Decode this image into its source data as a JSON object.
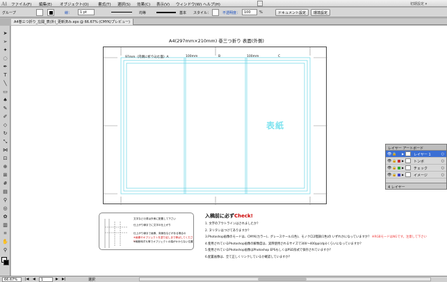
{
  "app": {
    "logo": "Ai",
    "workspace": "初期設定 ▾"
  },
  "menu": [
    "ファイル(F)",
    "編集(E)",
    "オブジェクト(O)",
    "書式(T)",
    "選択(S)",
    "効果(C)",
    "表示(V)",
    "ウィンドウ(W)",
    "ヘルプ(H)"
  ],
  "control": {
    "selection": "グループ",
    "stroke_label": "線：",
    "stroke_weight": "1 pt",
    "profile": "均等",
    "brush": "基本",
    "style_label": "スタイル：",
    "opacity_label": "不透明度：",
    "opacity": "100",
    "opacity_unit": "%",
    "doc_setup": "ドキュメント設定",
    "prefs": "環境設定"
  },
  "tab": {
    "title": "A4巻三つ折り_左開_表(外)_更新済み.eps @ 66.67% (CMYK/プレビュー)"
  },
  "document": {
    "title": "A4(297mm×210mm) 巻三つ折り 表面(外側)",
    "col_labels": [
      "97mm（内側に折り込む面）A",
      "100mm",
      "B",
      "100mm",
      "C"
    ],
    "panel_text": "表紙"
  },
  "guide": {
    "lines": [
      "文字などの書は外側に配置して下さい",
      "仕上がり線までに文字の仕上がり",
      "仕上がり線まで画像、背景色などがある場合の",
      "※画像やオブジェクトを塗り足しまで伸ばしてください",
      "※裁断時ずれ等でオブジェクトの端がかからない位置"
    ]
  },
  "checklist": {
    "title_prefix": "入稿前に必ず",
    "title_suffix": "Check!",
    "items": [
      "1. 文字のアウトラインはされましたか？",
      "2. ヌリタシはつけてありますか？",
      "3.Photoshop画像のモードは、CMYK(カラー)、グレースケール(1色)、モノクロ2階調(1色)の いずれかになっていますか？",
      "4.使用されているPhotoshop画像の解像度は、実際使用されるサイズで300〜400ppi(dpi)くらいになっていますか？",
      "5.使用されているPhotoshop画像はPhotoshop EPSもしくはPSD形式で保存されていますか？",
      "6.配置画像は、全て正しくリンクしているか確認していますか？"
    ],
    "note": "※RGBモードはNGです。注意して下さい"
  },
  "layers_panel": {
    "tabs": "レイヤー  アートボード",
    "layers": [
      {
        "name": "レイヤー 1",
        "color": "#3b6fd4"
      },
      {
        "name": "トンボ",
        "color": "#cc3333"
      },
      {
        "name": "チェック",
        "color": "#33aa33"
      },
      {
        "name": "イメージ",
        "color": "#4444cc"
      }
    ],
    "footer": "4 レイヤー"
  },
  "status": {
    "zoom": "66.67%",
    "page": "1",
    "mode": "選択"
  }
}
